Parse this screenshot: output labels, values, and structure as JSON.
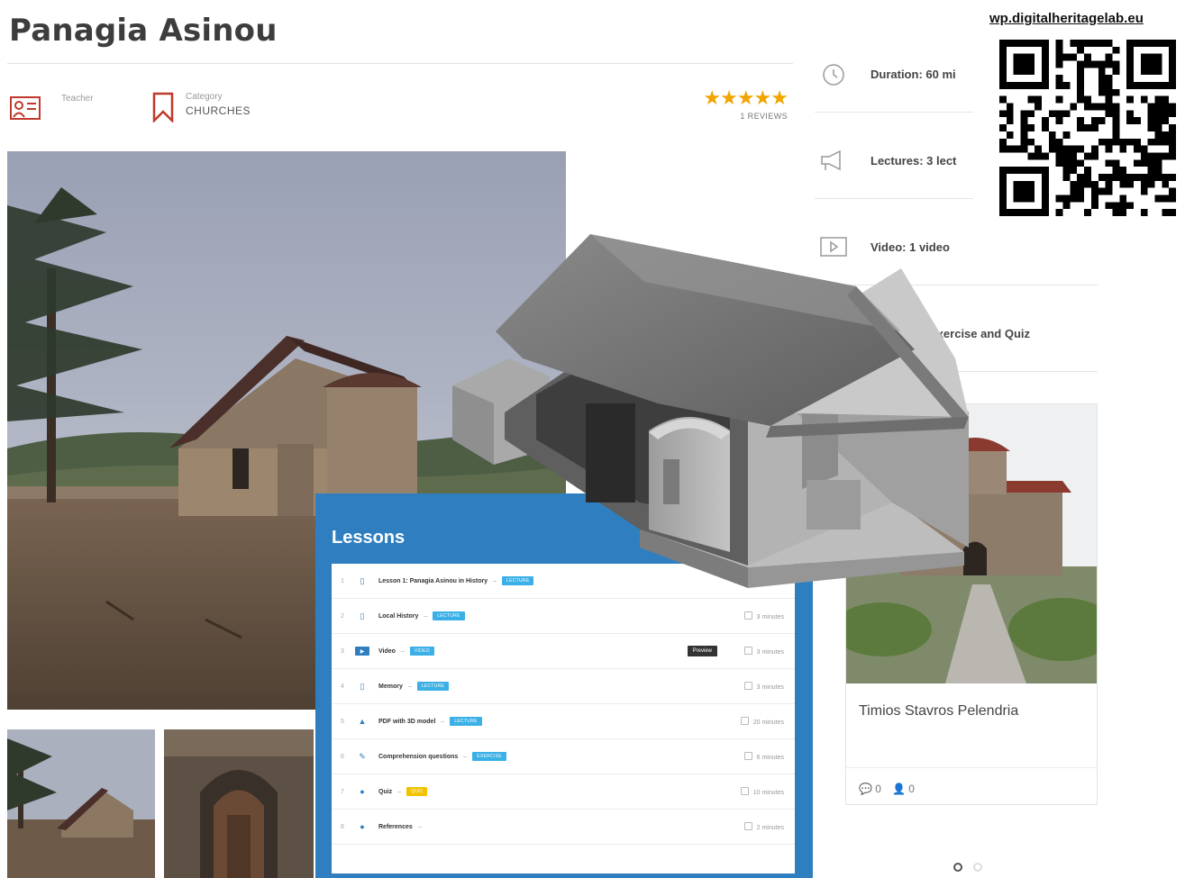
{
  "course": {
    "title": "Panagia Asinou",
    "teacher_label": "Teacher",
    "category_label": "Category",
    "category_value": "CHURCHES",
    "stars": "★★★★★",
    "rating_value": 5,
    "reviews": "1 REVIEWS"
  },
  "sidebar": {
    "items": [
      {
        "icon": "clock-icon",
        "label": "Duration: 60 mi"
      },
      {
        "icon": "megaphone-icon",
        "label": "Lectures: 3 lect"
      },
      {
        "icon": "video-icon",
        "label": "Video: 1 video"
      },
      {
        "icon": "",
        "label": "Activities, Exercise and Quiz"
      }
    ]
  },
  "qr": {
    "url": "wp.digitalheritagelab.eu"
  },
  "lessons": {
    "title": "Lessons",
    "rows": [
      {
        "num": "1",
        "icon": "document-icon",
        "name": "Lesson 1: Panagia Asinou in History",
        "badge": "LECTURE",
        "badge_color": "#3bb0e6",
        "preview": "",
        "duration": ""
      },
      {
        "num": "2",
        "icon": "document-icon",
        "name": "Local History",
        "badge": "LECTURE",
        "badge_color": "#3bb0e6",
        "preview": "",
        "duration": "3 minutes"
      },
      {
        "num": "3",
        "icon": "video-icon",
        "name": "Video",
        "badge": "VIDEO",
        "badge_color": "#3bb0e6",
        "preview": "Preview",
        "duration": "3 minutes"
      },
      {
        "num": "4",
        "icon": "document-icon",
        "name": "Memory",
        "badge": "LECTURE",
        "badge_color": "#3bb0e6",
        "preview": "",
        "duration": "3 minutes"
      },
      {
        "num": "5",
        "icon": "model-icon",
        "name": "PDF with 3D model",
        "badge": "LECTURE",
        "badge_color": "#3bb0e6",
        "preview": "",
        "duration": "20 minutes"
      },
      {
        "num": "6",
        "icon": "edit-icon",
        "name": "Comprehension questions",
        "badge": "EXERCISE",
        "badge_color": "#3bb0e6",
        "preview": "",
        "duration": "6 minutes"
      },
      {
        "num": "7",
        "icon": "quiz-icon",
        "name": "Quiz",
        "badge": "QUIZ",
        "badge_color": "#f2c200",
        "preview": "",
        "duration": "10 minutes"
      },
      {
        "num": "8",
        "icon": "chat-icon",
        "name": "References",
        "badge": "",
        "badge_color": "",
        "preview": "",
        "duration": "2 minutes"
      }
    ]
  },
  "related_course": {
    "title": "Timios Stavros Pelendria",
    "comments": "0",
    "students": "0"
  }
}
